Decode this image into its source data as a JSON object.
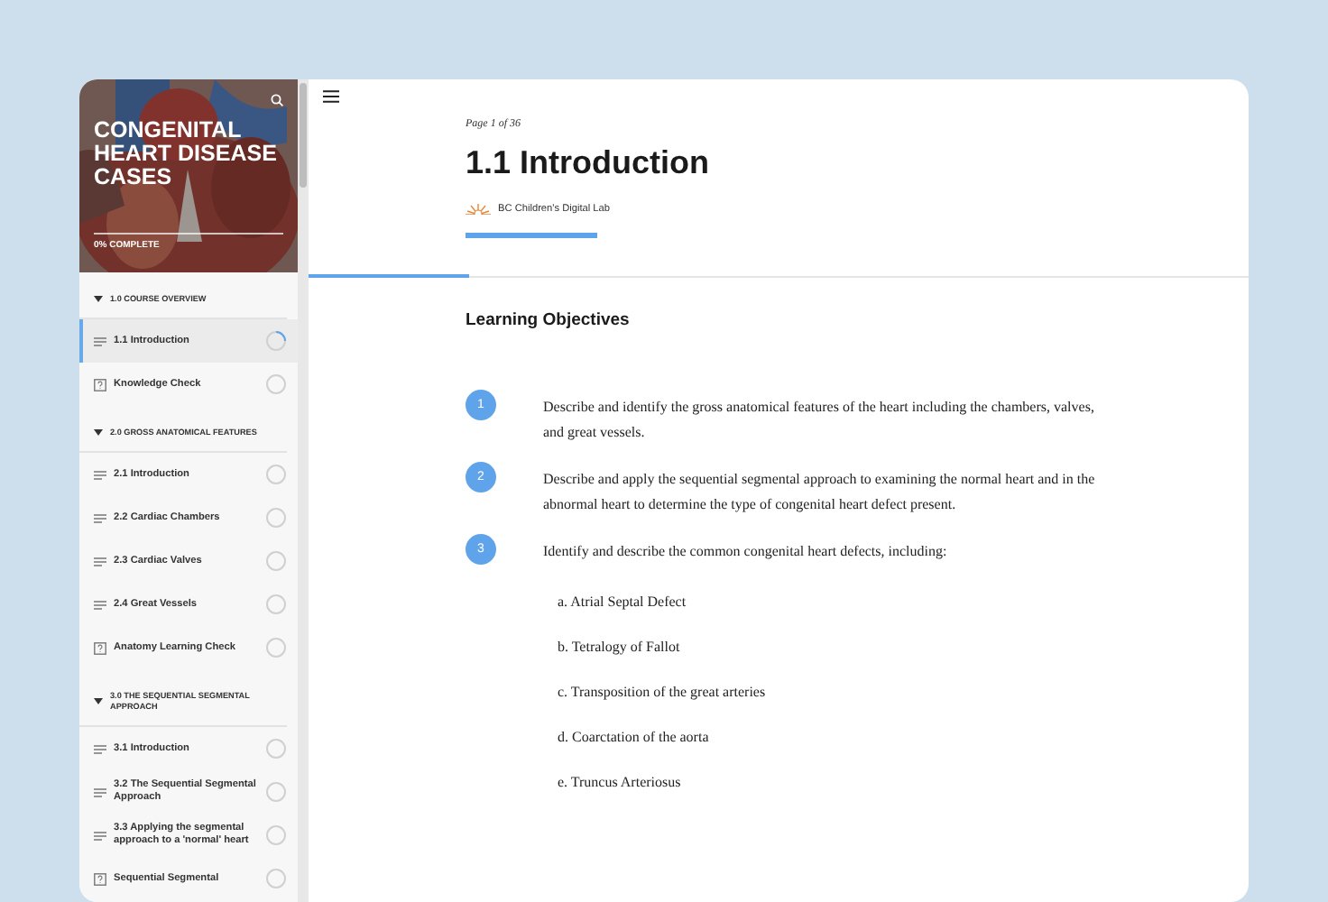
{
  "course": {
    "title": "CONGENITAL HEART DISEASE CASES",
    "progress_label": "0% COMPLETE"
  },
  "sidebar": {
    "sections": [
      {
        "title": "1.0 COURSE OVERVIEW",
        "expanded": true,
        "items": [
          {
            "label": "1.1 Introduction",
            "kind": "lesson",
            "selected": true,
            "in_progress": true
          },
          {
            "label": "Knowledge Check",
            "kind": "quiz",
            "selected": false,
            "in_progress": false
          }
        ]
      },
      {
        "title": "2.0 GROSS ANATOMICAL FEATURES",
        "expanded": true,
        "items": [
          {
            "label": "2.1 Introduction",
            "kind": "lesson",
            "selected": false,
            "in_progress": false
          },
          {
            "label": "2.2 Cardiac Chambers",
            "kind": "lesson",
            "selected": false,
            "in_progress": false
          },
          {
            "label": "2.3 Cardiac Valves",
            "kind": "lesson",
            "selected": false,
            "in_progress": false
          },
          {
            "label": "2.4 Great Vessels",
            "kind": "lesson",
            "selected": false,
            "in_progress": false
          },
          {
            "label": "Anatomy Learning Check",
            "kind": "quiz",
            "selected": false,
            "in_progress": false
          }
        ]
      },
      {
        "title": "3.0 THE SEQUENTIAL SEGMENTAL APPROACH",
        "expanded": true,
        "items": [
          {
            "label": "3.1 Introduction",
            "kind": "lesson",
            "selected": false,
            "in_progress": false
          },
          {
            "label": "3.2 The Sequential Segmental Approach",
            "kind": "lesson",
            "selected": false,
            "in_progress": false
          },
          {
            "label": "3.3 Applying the segmental approach to a 'normal' heart",
            "kind": "lesson",
            "selected": false,
            "in_progress": false
          },
          {
            "label": "Sequential Segmental",
            "kind": "quiz",
            "selected": false,
            "in_progress": false
          }
        ]
      }
    ]
  },
  "lesson": {
    "page": "Page 1 of 36",
    "title": "1.1 Introduction",
    "author": "BC Children's Digital Lab",
    "scroll_progress": {
      "level": 0.17
    }
  },
  "objectives": {
    "heading": "Learning Objectives",
    "items": [
      {
        "number": "1",
        "text": "Describe and identify the gross anatomical features of the heart including the chambers, valves, and great vessels."
      },
      {
        "number": "2",
        "text": "Describe and apply the sequential segmental approach to examining the normal heart and in the abnormal heart to determine the type of congenital heart defect present."
      },
      {
        "number": "3",
        "text": "Identify and describe the common congenital heart defects, including:",
        "subitems": [
          "a. Atrial Septal Defect",
          "b. Tetralogy of Fallot",
          "c. Transposition of the great arteries",
          "d. Coarctation of the aorta",
          "e. Truncus Arteriosus"
        ]
      }
    ]
  }
}
